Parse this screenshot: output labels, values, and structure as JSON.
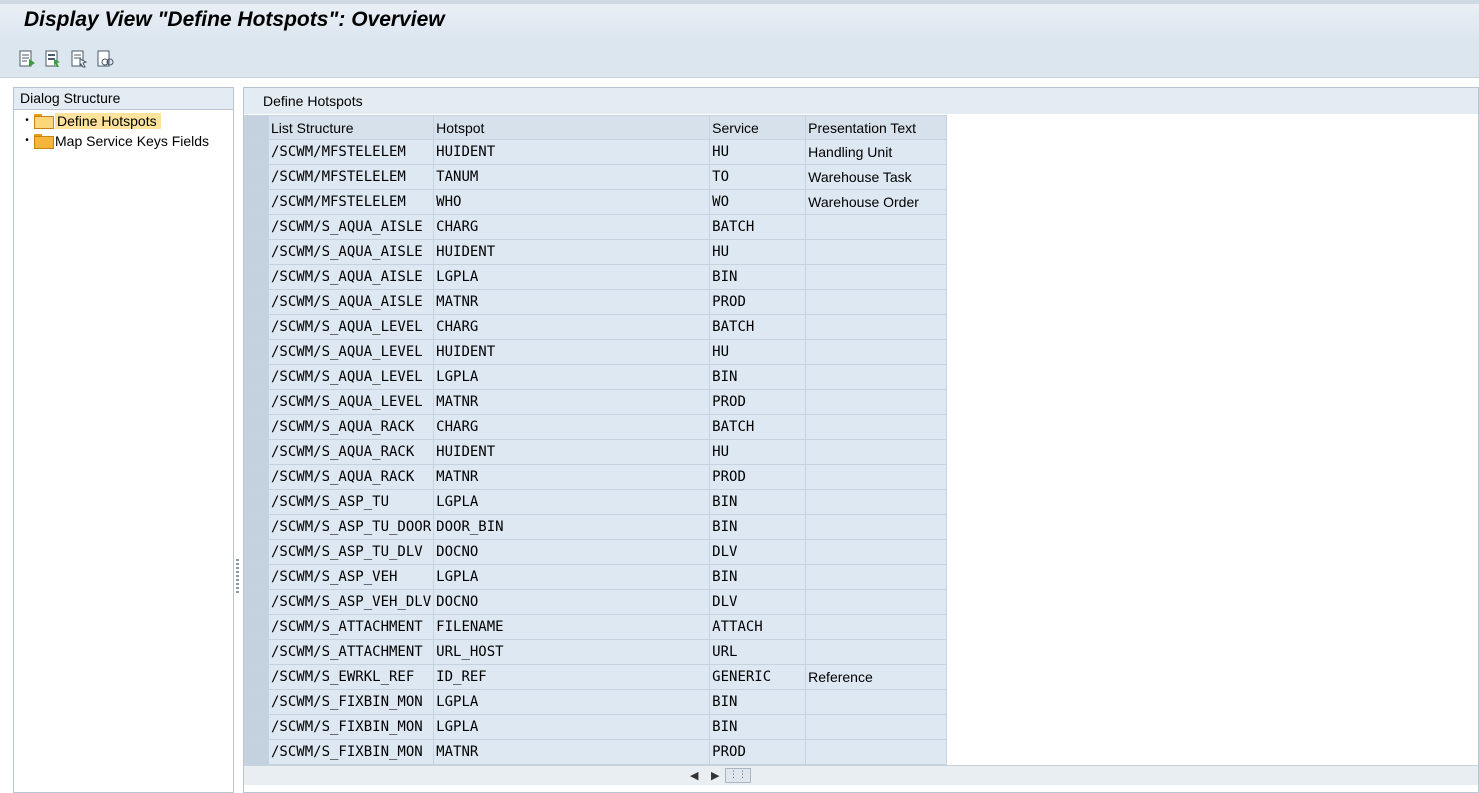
{
  "window": {
    "title": "Display View \"Define Hotspots\": Overview"
  },
  "toolbar": {
    "buttons": [
      {
        "icon": "details-icon"
      },
      {
        "icon": "select-all-icon"
      },
      {
        "icon": "select-block-icon"
      },
      {
        "icon": "find-icon"
      }
    ]
  },
  "dialog_structure": {
    "header": "Dialog Structure",
    "items": [
      {
        "label": "Define Hotspots",
        "selected": true
      },
      {
        "label": "Map Service Keys Fields",
        "selected": false
      }
    ]
  },
  "table": {
    "title": "Define Hotspots",
    "columns": [
      "List Structure",
      "Hotspot",
      "Service",
      "Presentation Text"
    ],
    "rows": [
      [
        "/SCWM/MFSTELELEM",
        "HUIDENT",
        "HU",
        "Handling Unit"
      ],
      [
        "/SCWM/MFSTELELEM",
        "TANUM",
        "TO",
        "Warehouse Task"
      ],
      [
        "/SCWM/MFSTELELEM",
        "WHO",
        "WO",
        "Warehouse Order"
      ],
      [
        "/SCWM/S_AQUA_AISLE",
        "CHARG",
        "BATCH",
        ""
      ],
      [
        "/SCWM/S_AQUA_AISLE",
        "HUIDENT",
        "HU",
        ""
      ],
      [
        "/SCWM/S_AQUA_AISLE",
        "LGPLA",
        "BIN",
        ""
      ],
      [
        "/SCWM/S_AQUA_AISLE",
        "MATNR",
        "PROD",
        ""
      ],
      [
        "/SCWM/S_AQUA_LEVEL",
        "CHARG",
        "BATCH",
        ""
      ],
      [
        "/SCWM/S_AQUA_LEVEL",
        "HUIDENT",
        "HU",
        ""
      ],
      [
        "/SCWM/S_AQUA_LEVEL",
        "LGPLA",
        "BIN",
        ""
      ],
      [
        "/SCWM/S_AQUA_LEVEL",
        "MATNR",
        "PROD",
        ""
      ],
      [
        "/SCWM/S_AQUA_RACK",
        "CHARG",
        "BATCH",
        ""
      ],
      [
        "/SCWM/S_AQUA_RACK",
        "HUIDENT",
        "HU",
        ""
      ],
      [
        "/SCWM/S_AQUA_RACK",
        "MATNR",
        "PROD",
        ""
      ],
      [
        "/SCWM/S_ASP_TU",
        "LGPLA",
        "BIN",
        ""
      ],
      [
        "/SCWM/S_ASP_TU_DOOR",
        "DOOR_BIN",
        "BIN",
        ""
      ],
      [
        "/SCWM/S_ASP_TU_DLV",
        "DOCNO",
        "DLV",
        ""
      ],
      [
        "/SCWM/S_ASP_VEH",
        "LGPLA",
        "BIN",
        ""
      ],
      [
        "/SCWM/S_ASP_VEH_DLV",
        "DOCNO",
        "DLV",
        ""
      ],
      [
        "/SCWM/S_ATTACHMENT",
        "FILENAME",
        "ATTACH",
        ""
      ],
      [
        "/SCWM/S_ATTACHMENT",
        "URL_HOST",
        "URL",
        ""
      ],
      [
        "/SCWM/S_EWRKL_REF",
        "ID_REF",
        "GENERIC",
        "Reference"
      ],
      [
        "/SCWM/S_FIXBIN_MON",
        "LGPLA",
        "BIN",
        ""
      ],
      [
        "/SCWM/S_FIXBIN_MON",
        "LGPLA",
        "BIN",
        ""
      ],
      [
        "/SCWM/S_FIXBIN_MON",
        "MATNR",
        "PROD",
        ""
      ]
    ]
  },
  "scrollbar": {
    "left_arrow": "◀",
    "right_arrow": "▶",
    "thumb": "⋮⋮"
  }
}
